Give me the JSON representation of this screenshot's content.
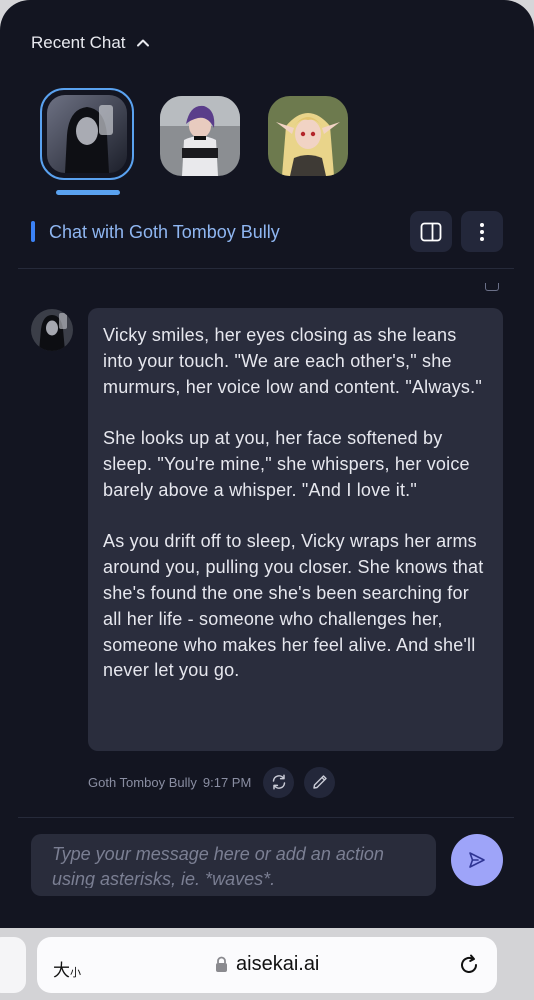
{
  "recent": {
    "header_label": "Recent Chat",
    "avatars": [
      {
        "name": "Goth Tomboy Bully",
        "active": true
      },
      {
        "name": "purple-haired character",
        "active": false
      },
      {
        "name": "blonde elf character",
        "active": false
      }
    ]
  },
  "chat": {
    "title": "Chat with Goth Tomboy Bully"
  },
  "message": {
    "paragraphs": [
      "Vicky smiles, her eyes closing as she leans into your touch. \"We are each other's,\" she murmurs, her voice low and content. \"Always.\"",
      "She looks up at you, her face softened by sleep. \"You're mine,\" she whispers, her voice barely above a whisper. \"And I love it.\"",
      "As you drift off to sleep, Vicky wraps her arms around you, pulling you closer. She knows that she's found the one she's been searching for all her life - someone who challenges her, someone who makes her feel alive. And she'll never let you go."
    ],
    "sender": "Goth Tomboy Bully",
    "time": "9:17 PM"
  },
  "composer": {
    "placeholder": "Type your message here or add an action using asterisks, ie. *waves*.",
    "value": ""
  },
  "browser": {
    "text_size_big": "大",
    "text_size_small": "小",
    "url": "aisekai.ai"
  },
  "colors": {
    "background": "#131521",
    "accent": "#3b82f6",
    "bubble": "#2a2d3d",
    "send_button": "#9ea4f9"
  }
}
